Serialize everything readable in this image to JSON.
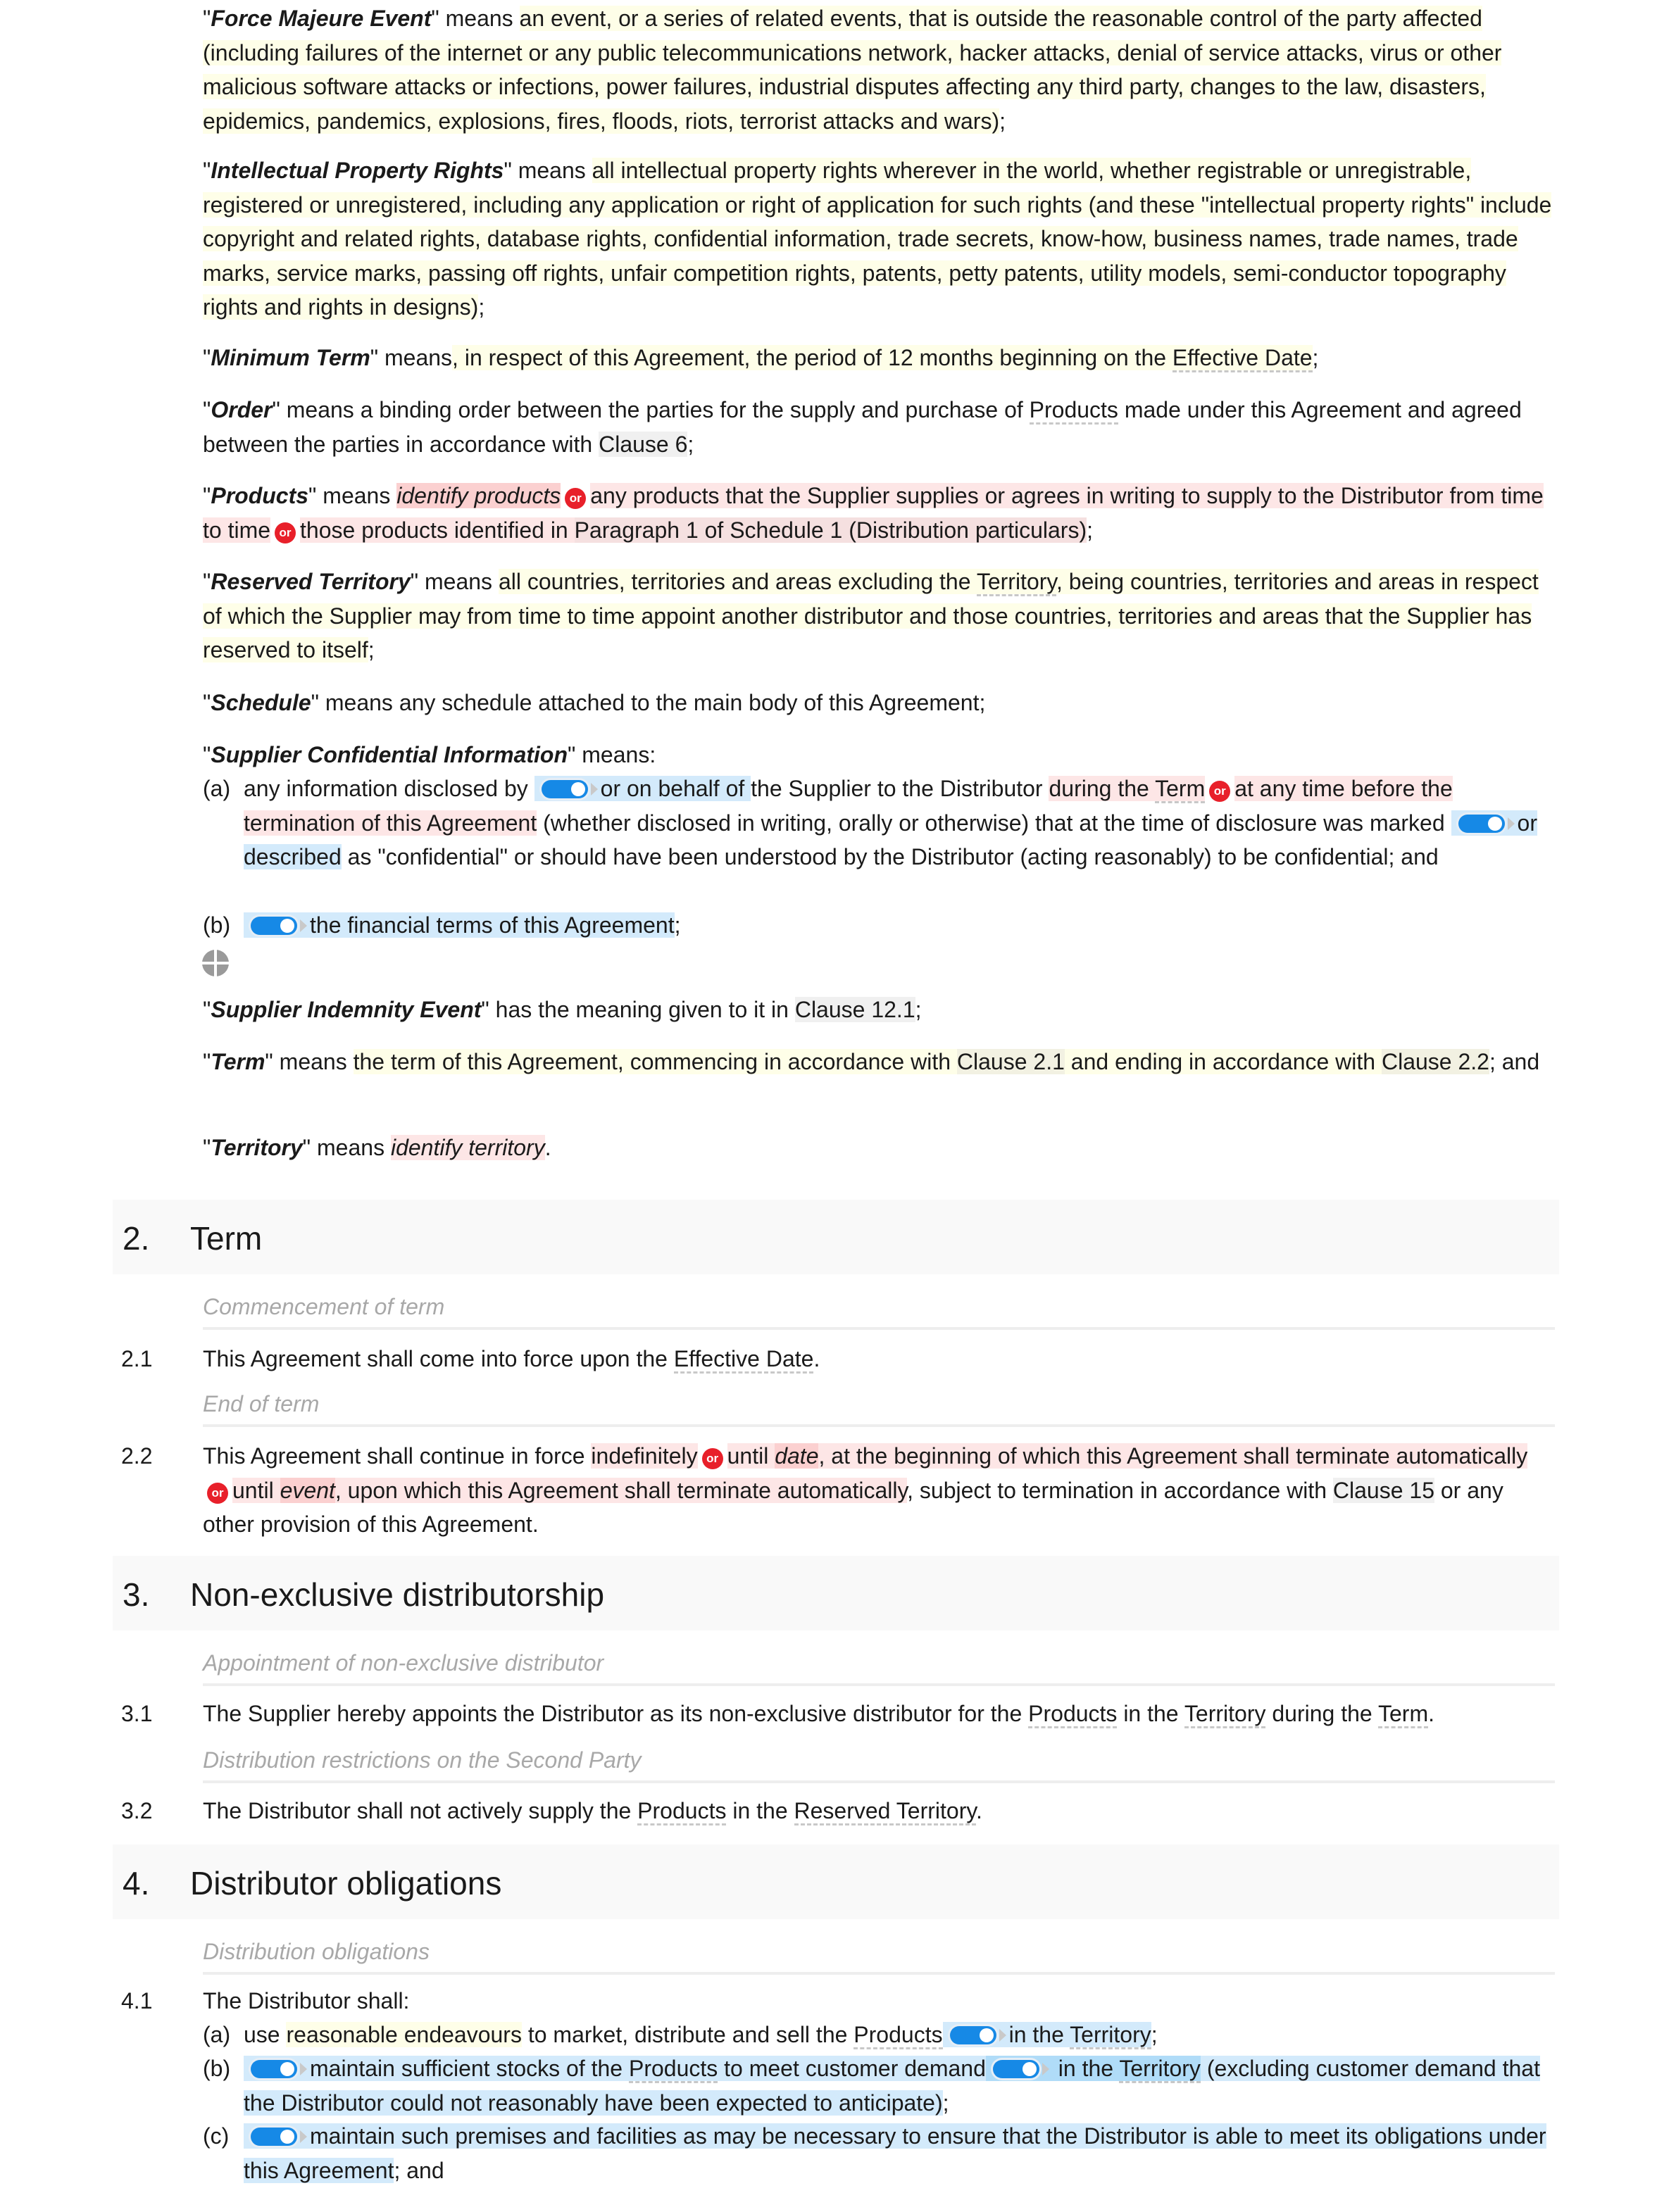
{
  "definitions": {
    "force_majeure": {
      "term": "Force Majeure Event",
      "means": " means ",
      "body": "an event, or a series of related events, that is outside the reasonable control of the party affected (including failures of the internet or any public telecommunications network, hacker attacks, denial of service attacks, virus or other malicious software attacks or infections, power failures, industrial disputes affecting any third party, changes to the law, disasters, epidemics, pandemics, explosions, fires, floods, riots, terrorist attacks and wars)",
      "end": ";"
    },
    "ipr": {
      "term": "Intellectual Property Rights",
      "means": " means ",
      "body": "all intellectual property rights wherever in the world, whether registrable or unregistrable, registered or unregistered, including any application or right of application for such rights (and these \"intellectual property rights\" include copyright and related rights, database rights, confidential information, trade secrets, know-how, business names, trade names, trade marks, service marks, passing off rights, unfair competition rights, patents, petty patents, utility models, semi-conductor topography rights and rights in designs)",
      "end": ";"
    },
    "minimum_term": {
      "term": "Minimum Term",
      "means": " means",
      "body": ", in respect of this Agreement, the period of 12 months beginning on the ",
      "ref": "Effective Date",
      "end": ";"
    },
    "order": {
      "term": "Order",
      "text1": " means a binding order between the parties for the supply and purchase of ",
      "ref1": "Products",
      "text2": " made under this Agreement and agreed between the parties in accordance with ",
      "ref2": "Clause 6",
      "end": ";"
    },
    "products": {
      "term": "Products",
      "means": " means ",
      "opt1": "identify products",
      "or": "or",
      "opt2": "any products that the Supplier supplies or agrees in writing to supply to the Distributor from time to time",
      "opt3a": "those products identified in ",
      "opt3ref": "Paragraph 1 of Schedule 1 (Distribution particulars)",
      "end": ";"
    },
    "reserved_territory": {
      "term": "Reserved Territory",
      "means": " means ",
      "body1": "all countries, territories and areas excluding the ",
      "ref": "Territory",
      "body2": ", being countries, territories and areas in respect of which the Supplier may from time to time appoint another distributor and those countries, territories and areas that the Supplier has reserved to itself",
      "end": ";"
    },
    "schedule": {
      "term": "Schedule",
      "body": " means any schedule attached to the main body of this Agreement;"
    },
    "supplier_ci": {
      "term": "Supplier Confidential Information",
      "means": " means:",
      "items": [
        {
          "label": "(a)",
          "t1": "any information disclosed by ",
          "toggle1": "or on behalf of ",
          "t2": "the Supplier to the Distributor ",
          "alt1": "during the ",
          "alt1ref": "Term",
          "or": "or",
          "alt2": "at any time before the termination of this Agreement",
          "t3": " (whether disclosed in writing, orally or otherwise) that at the time of disclosure was marked ",
          "toggle2": "or described",
          "t4": " as \"confidential\" or should have been understood by the Distributor (acting reasonably) to be confidential; and"
        },
        {
          "label": "(b)",
          "toggle": "the financial terms of this Agreement",
          "end": ";"
        }
      ]
    },
    "supplier_indemnity": {
      "term": "Supplier Indemnity Event",
      "body": " has the meaning given to it in ",
      "ref": "Clause 12.1",
      "end": ";"
    },
    "term_def": {
      "term": "Term",
      "means": " means ",
      "body1": "the term of this Agreement, commencing in accordance with ",
      "ref1": "Clause 2.1",
      "body2": " and ending in accordance with ",
      "ref2": "Clause 2.2",
      "end": "; and"
    },
    "territory": {
      "term": "Territory",
      "means": " means ",
      "placeholder": "identify territory",
      "end": "."
    }
  },
  "sections": [
    {
      "num": "2.",
      "title": "Term",
      "clauses": [
        {
          "caption": "Commencement of term",
          "num": "2.1",
          "t1": "This Agreement shall come into force upon the ",
          "ref": "Effective Date",
          "end": "."
        },
        {
          "caption": "End of term",
          "num": "2.2",
          "t1": "This Agreement shall continue in force ",
          "alt1": "indefinitely",
          "or": "or",
          "alt2a": "until ",
          "alt2ph": "date",
          "alt2b": ", at the beginning of which this Agreement shall terminate automatically",
          "alt3a": "until ",
          "alt3ph": "event",
          "alt3b": ", upon which this Agreement shall terminate automatically",
          "t2": ", subject to termination in accordance with ",
          "ref": "Clause 15",
          "t3": " or any other provision of this Agreement."
        }
      ]
    },
    {
      "num": "3.",
      "title": "Non-exclusive distributorship",
      "clauses": [
        {
          "caption": "Appointment of non-exclusive distributor",
          "num": "3.1",
          "t1": "The Supplier hereby appoints the Distributor as its non-exclusive distributor for the ",
          "ref1": "Products",
          "t2": " in the ",
          "ref2": "Territory",
          "t3": " during the ",
          "ref3": "Term",
          "end": "."
        },
        {
          "caption": "Distribution restrictions on the Second Party",
          "num": "3.2",
          "t1": "The Distributor shall not actively supply the ",
          "ref1": "Products",
          "t2": " in the ",
          "ref2": "Reserved Territory",
          "end": "."
        }
      ]
    },
    {
      "num": "4.",
      "title": "Distributor obligations",
      "clauses": [
        {
          "caption": "Distribution obligations",
          "num": "4.1",
          "intro": "The Distributor shall:",
          "items": [
            {
              "label": "(a)",
              "t1": "use ",
              "opt": "reasonable endeavours",
              "t2": " to market, distribute and sell the ",
              "ref1": "Products",
              "toggle_a": "in the ",
              "toggle_ref": "Territory",
              "end": ";"
            },
            {
              "label": "(b)",
              "t1": "maintain sufficient stocks of the ",
              "ref1": "Products",
              "t2": " to meet customer demand",
              "inner_a": " in the ",
              "inner_ref": "Territory",
              "t3": " (excluding customer demand that the Distributor could not reasonably have been expected to anticipate)",
              "end": ";"
            },
            {
              "label": "(c)",
              "t1": "maintain such premises and facilities as may be necessary to ensure that the Distributor is able to meet its obligations under this Agreement",
              "end": "; and"
            }
          ]
        }
      ]
    }
  ]
}
